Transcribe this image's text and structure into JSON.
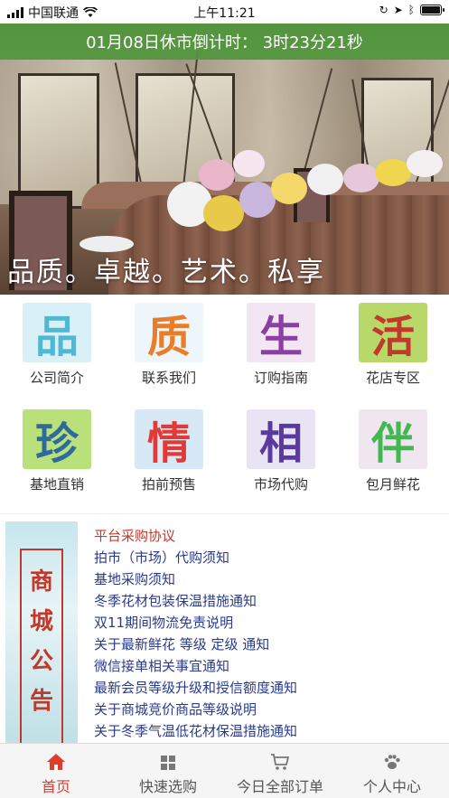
{
  "status_bar": {
    "carrier": "中国联通",
    "time": "上午11:21"
  },
  "banner": {
    "countdown": "01月08日休市倒计时： 3时23分21秒",
    "slogan": "品质。卓越。艺术。私享"
  },
  "grid": [
    {
      "char": "品",
      "label": "公司简介",
      "color": "#4fb9d4",
      "bg": "#d9f1f6"
    },
    {
      "char": "质",
      "label": "联系我们",
      "color": "#e87e2c",
      "bg": "#eef6fb"
    },
    {
      "char": "生",
      "label": "订购指南",
      "color": "#8a3ea6",
      "bg": "#f3e6f3"
    },
    {
      "char": "活",
      "label": "花店专区",
      "color": "#c0392b",
      "bg": "#b8d96a"
    },
    {
      "char": "珍",
      "label": "基地直销",
      "color": "#2d6aa0",
      "bg": "#b9e07a"
    },
    {
      "char": "情",
      "label": "拍前预售",
      "color": "#e53935",
      "bg": "#d7e9f6"
    },
    {
      "char": "相",
      "label": "市场代购",
      "color": "#5b3a9e",
      "bg": "#e9e4f4"
    },
    {
      "char": "伴",
      "label": "包月鲜花",
      "color": "#3fb950",
      "bg": "#f0e6ef"
    }
  ],
  "notice": {
    "banner_text": "商城公告",
    "items": [
      "平台采购协议",
      "拍市（市场）代购须知",
      "基地采购须知",
      "冬季花材包装保温措施通知",
      "双11期间物流免责说明",
      "关于最新鲜花 等级 定级 通知",
      "微信接单相关事宜通知",
      "最新会员等级升级和授信额度通知",
      "关于商城竞价商品等级说明",
      "关于冬季气温低花材保温措施通知"
    ]
  },
  "tabbar": [
    {
      "label": "首页",
      "icon": "home-icon",
      "active": true
    },
    {
      "label": "快速选购",
      "icon": "grid-icon",
      "active": false
    },
    {
      "label": "今日全部订单",
      "icon": "cart-icon",
      "active": false
    },
    {
      "label": "个人中心",
      "icon": "paw-icon",
      "active": false
    }
  ]
}
